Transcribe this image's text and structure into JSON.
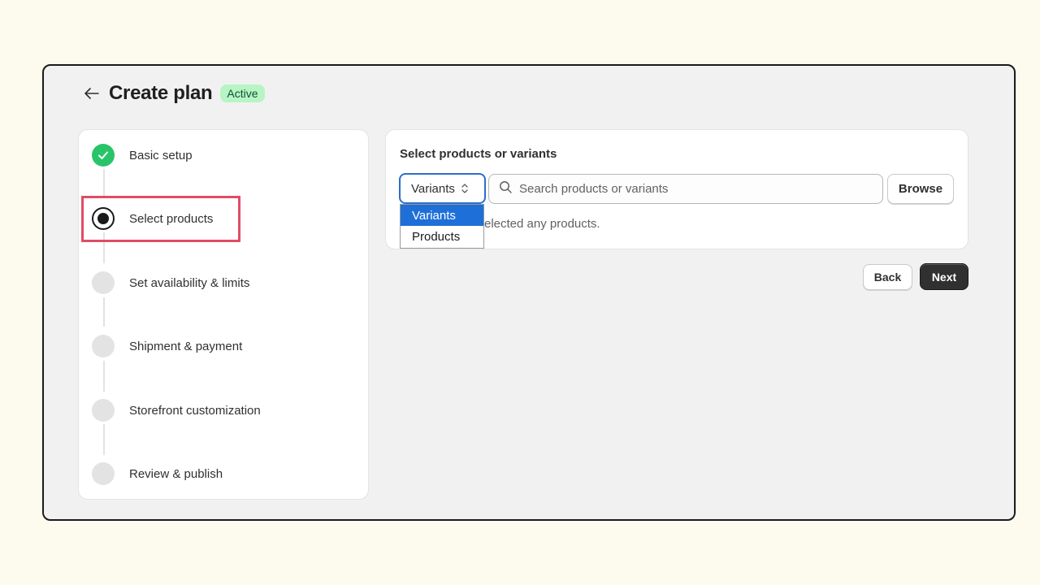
{
  "header": {
    "title": "Create plan",
    "badge": "Active",
    "back_icon": "arrow-left-icon"
  },
  "steps": [
    {
      "label": "Basic setup",
      "status": "completed",
      "icon": "checkmark-icon"
    },
    {
      "label": "Select products",
      "status": "current"
    },
    {
      "label": "Set availability & limits",
      "status": "upcoming"
    },
    {
      "label": "Shipment & payment",
      "status": "upcoming"
    },
    {
      "label": "Storefront customization",
      "status": "upcoming"
    },
    {
      "label": "Review & publish",
      "status": "upcoming"
    }
  ],
  "main": {
    "section_title": "Select products or variants",
    "select": {
      "value": "Variants",
      "options": [
        "Variants",
        "Products"
      ],
      "selected_index": 0,
      "icon": "chevron-up-down-icon"
    },
    "search": {
      "placeholder": "Search products or variants",
      "value": "",
      "icon": "search-icon"
    },
    "browse_label": "Browse",
    "empty_text": "elected any products."
  },
  "footer": {
    "back_label": "Back",
    "next_label": "Next"
  },
  "colors": {
    "page_bg": "#fcfbee",
    "frame_bg": "#f1f1f1",
    "badge_bg": "#b7f5c4",
    "done_green": "#29c46a",
    "focus_blue": "#2c6ecb",
    "option_selected": "#1f6fd8",
    "highlight_red": "#e04d66",
    "primary_button": "#303030"
  }
}
